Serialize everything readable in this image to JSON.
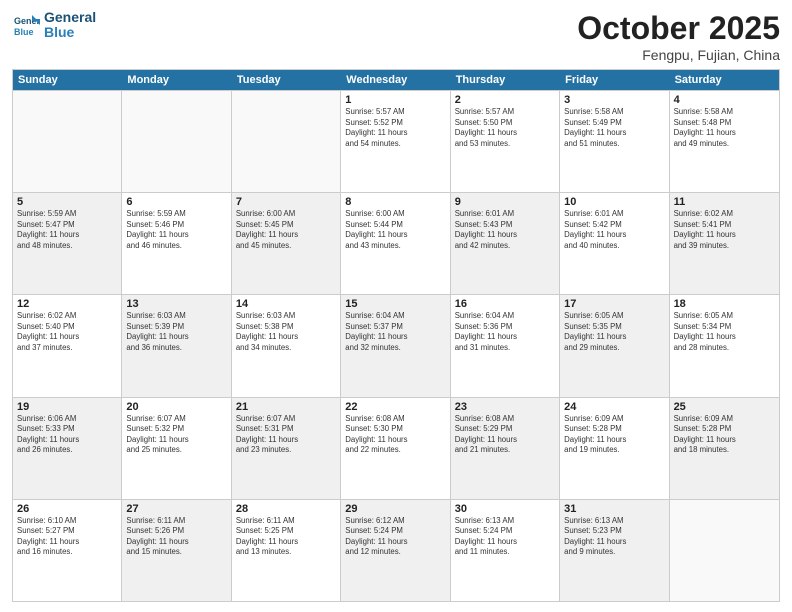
{
  "header": {
    "logo_line1": "General",
    "logo_line2": "Blue",
    "month_title": "October 2025",
    "location": "Fengpu, Fujian, China"
  },
  "weekdays": [
    "Sunday",
    "Monday",
    "Tuesday",
    "Wednesday",
    "Thursday",
    "Friday",
    "Saturday"
  ],
  "weeks": [
    [
      {
        "day": "",
        "info": "",
        "empty": true
      },
      {
        "day": "",
        "info": "",
        "empty": true
      },
      {
        "day": "",
        "info": "",
        "empty": true
      },
      {
        "day": "1",
        "info": "Sunrise: 5:57 AM\nSunset: 5:52 PM\nDaylight: 11 hours\nand 54 minutes."
      },
      {
        "day": "2",
        "info": "Sunrise: 5:57 AM\nSunset: 5:50 PM\nDaylight: 11 hours\nand 53 minutes."
      },
      {
        "day": "3",
        "info": "Sunrise: 5:58 AM\nSunset: 5:49 PM\nDaylight: 11 hours\nand 51 minutes."
      },
      {
        "day": "4",
        "info": "Sunrise: 5:58 AM\nSunset: 5:48 PM\nDaylight: 11 hours\nand 49 minutes."
      }
    ],
    [
      {
        "day": "5",
        "info": "Sunrise: 5:59 AM\nSunset: 5:47 PM\nDaylight: 11 hours\nand 48 minutes.",
        "shaded": true
      },
      {
        "day": "6",
        "info": "Sunrise: 5:59 AM\nSunset: 5:46 PM\nDaylight: 11 hours\nand 46 minutes."
      },
      {
        "day": "7",
        "info": "Sunrise: 6:00 AM\nSunset: 5:45 PM\nDaylight: 11 hours\nand 45 minutes.",
        "shaded": true
      },
      {
        "day": "8",
        "info": "Sunrise: 6:00 AM\nSunset: 5:44 PM\nDaylight: 11 hours\nand 43 minutes."
      },
      {
        "day": "9",
        "info": "Sunrise: 6:01 AM\nSunset: 5:43 PM\nDaylight: 11 hours\nand 42 minutes.",
        "shaded": true
      },
      {
        "day": "10",
        "info": "Sunrise: 6:01 AM\nSunset: 5:42 PM\nDaylight: 11 hours\nand 40 minutes."
      },
      {
        "day": "11",
        "info": "Sunrise: 6:02 AM\nSunset: 5:41 PM\nDaylight: 11 hours\nand 39 minutes.",
        "shaded": true
      }
    ],
    [
      {
        "day": "12",
        "info": "Sunrise: 6:02 AM\nSunset: 5:40 PM\nDaylight: 11 hours\nand 37 minutes."
      },
      {
        "day": "13",
        "info": "Sunrise: 6:03 AM\nSunset: 5:39 PM\nDaylight: 11 hours\nand 36 minutes.",
        "shaded": true
      },
      {
        "day": "14",
        "info": "Sunrise: 6:03 AM\nSunset: 5:38 PM\nDaylight: 11 hours\nand 34 minutes."
      },
      {
        "day": "15",
        "info": "Sunrise: 6:04 AM\nSunset: 5:37 PM\nDaylight: 11 hours\nand 32 minutes.",
        "shaded": true
      },
      {
        "day": "16",
        "info": "Sunrise: 6:04 AM\nSunset: 5:36 PM\nDaylight: 11 hours\nand 31 minutes."
      },
      {
        "day": "17",
        "info": "Sunrise: 6:05 AM\nSunset: 5:35 PM\nDaylight: 11 hours\nand 29 minutes.",
        "shaded": true
      },
      {
        "day": "18",
        "info": "Sunrise: 6:05 AM\nSunset: 5:34 PM\nDaylight: 11 hours\nand 28 minutes."
      }
    ],
    [
      {
        "day": "19",
        "info": "Sunrise: 6:06 AM\nSunset: 5:33 PM\nDaylight: 11 hours\nand 26 minutes.",
        "shaded": true
      },
      {
        "day": "20",
        "info": "Sunrise: 6:07 AM\nSunset: 5:32 PM\nDaylight: 11 hours\nand 25 minutes."
      },
      {
        "day": "21",
        "info": "Sunrise: 6:07 AM\nSunset: 5:31 PM\nDaylight: 11 hours\nand 23 minutes.",
        "shaded": true
      },
      {
        "day": "22",
        "info": "Sunrise: 6:08 AM\nSunset: 5:30 PM\nDaylight: 11 hours\nand 22 minutes."
      },
      {
        "day": "23",
        "info": "Sunrise: 6:08 AM\nSunset: 5:29 PM\nDaylight: 11 hours\nand 21 minutes.",
        "shaded": true
      },
      {
        "day": "24",
        "info": "Sunrise: 6:09 AM\nSunset: 5:28 PM\nDaylight: 11 hours\nand 19 minutes."
      },
      {
        "day": "25",
        "info": "Sunrise: 6:09 AM\nSunset: 5:28 PM\nDaylight: 11 hours\nand 18 minutes.",
        "shaded": true
      }
    ],
    [
      {
        "day": "26",
        "info": "Sunrise: 6:10 AM\nSunset: 5:27 PM\nDaylight: 11 hours\nand 16 minutes."
      },
      {
        "day": "27",
        "info": "Sunrise: 6:11 AM\nSunset: 5:26 PM\nDaylight: 11 hours\nand 15 minutes.",
        "shaded": true
      },
      {
        "day": "28",
        "info": "Sunrise: 6:11 AM\nSunset: 5:25 PM\nDaylight: 11 hours\nand 13 minutes."
      },
      {
        "day": "29",
        "info": "Sunrise: 6:12 AM\nSunset: 5:24 PM\nDaylight: 11 hours\nand 12 minutes.",
        "shaded": true
      },
      {
        "day": "30",
        "info": "Sunrise: 6:13 AM\nSunset: 5:24 PM\nDaylight: 11 hours\nand 11 minutes."
      },
      {
        "day": "31",
        "info": "Sunrise: 6:13 AM\nSunset: 5:23 PM\nDaylight: 11 hours\nand 9 minutes.",
        "shaded": true
      },
      {
        "day": "",
        "info": "",
        "empty": true
      }
    ]
  ]
}
